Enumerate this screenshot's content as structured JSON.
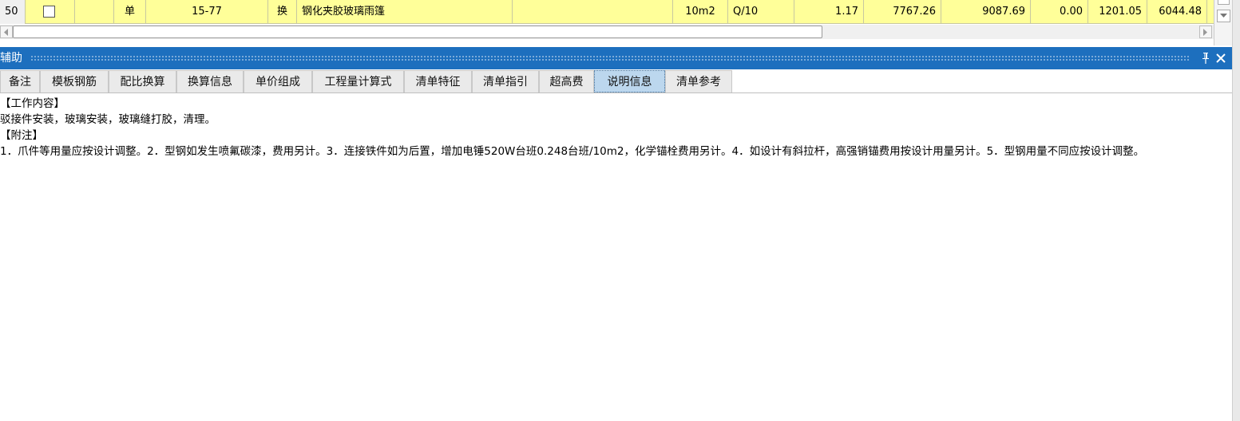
{
  "grid_row": {
    "row_number": "50",
    "checkbox_checked": false,
    "type": "单",
    "code": "15-77",
    "change_flag": "换",
    "name": "钢化夹胶玻璃雨篷",
    "spec": "",
    "unit": "10m2",
    "quantity_expr": "Q/10",
    "quantity": "1.17",
    "unit_price": "7767.26",
    "total_price": "9087.69",
    "col_a": "0.00",
    "col_b": "1201.05",
    "col_c": "6044.48"
  },
  "panel": {
    "title": "辅助",
    "pin_icon": "pin-icon",
    "close_icon": "close-icon"
  },
  "tabs": [
    {
      "label": "备注"
    },
    {
      "label": "模板钢筋"
    },
    {
      "label": "配比换算"
    },
    {
      "label": "换算信息"
    },
    {
      "label": "单价组成"
    },
    {
      "label": "工程量计算式"
    },
    {
      "label": "清单特征"
    },
    {
      "label": "清单指引"
    },
    {
      "label": "超高费"
    },
    {
      "label": "说明信息",
      "active": true
    },
    {
      "label": "清单参考"
    }
  ],
  "content": {
    "work_heading": "【工作内容】",
    "work_text": "驳接件安装，玻璃安装，玻璃缝打胶，清理。",
    "note_heading": "【附注】",
    "note_text": "1．爪件等用量应按设计调整。2．型钢如发生喷氟碳漆，费用另计。3．连接铁件如为后置，增加电锤520W台班0.248台班/10m2，化学锚栓费用另计。4．如设计有斜拉杆，高强销锚费用按设计用量另计。5．型钢用量不同应按设计调整。"
  },
  "colors": {
    "row_highlight": "#ffff99",
    "title_bar": "#1d6fbe",
    "active_tab": "#bcd7ee"
  }
}
